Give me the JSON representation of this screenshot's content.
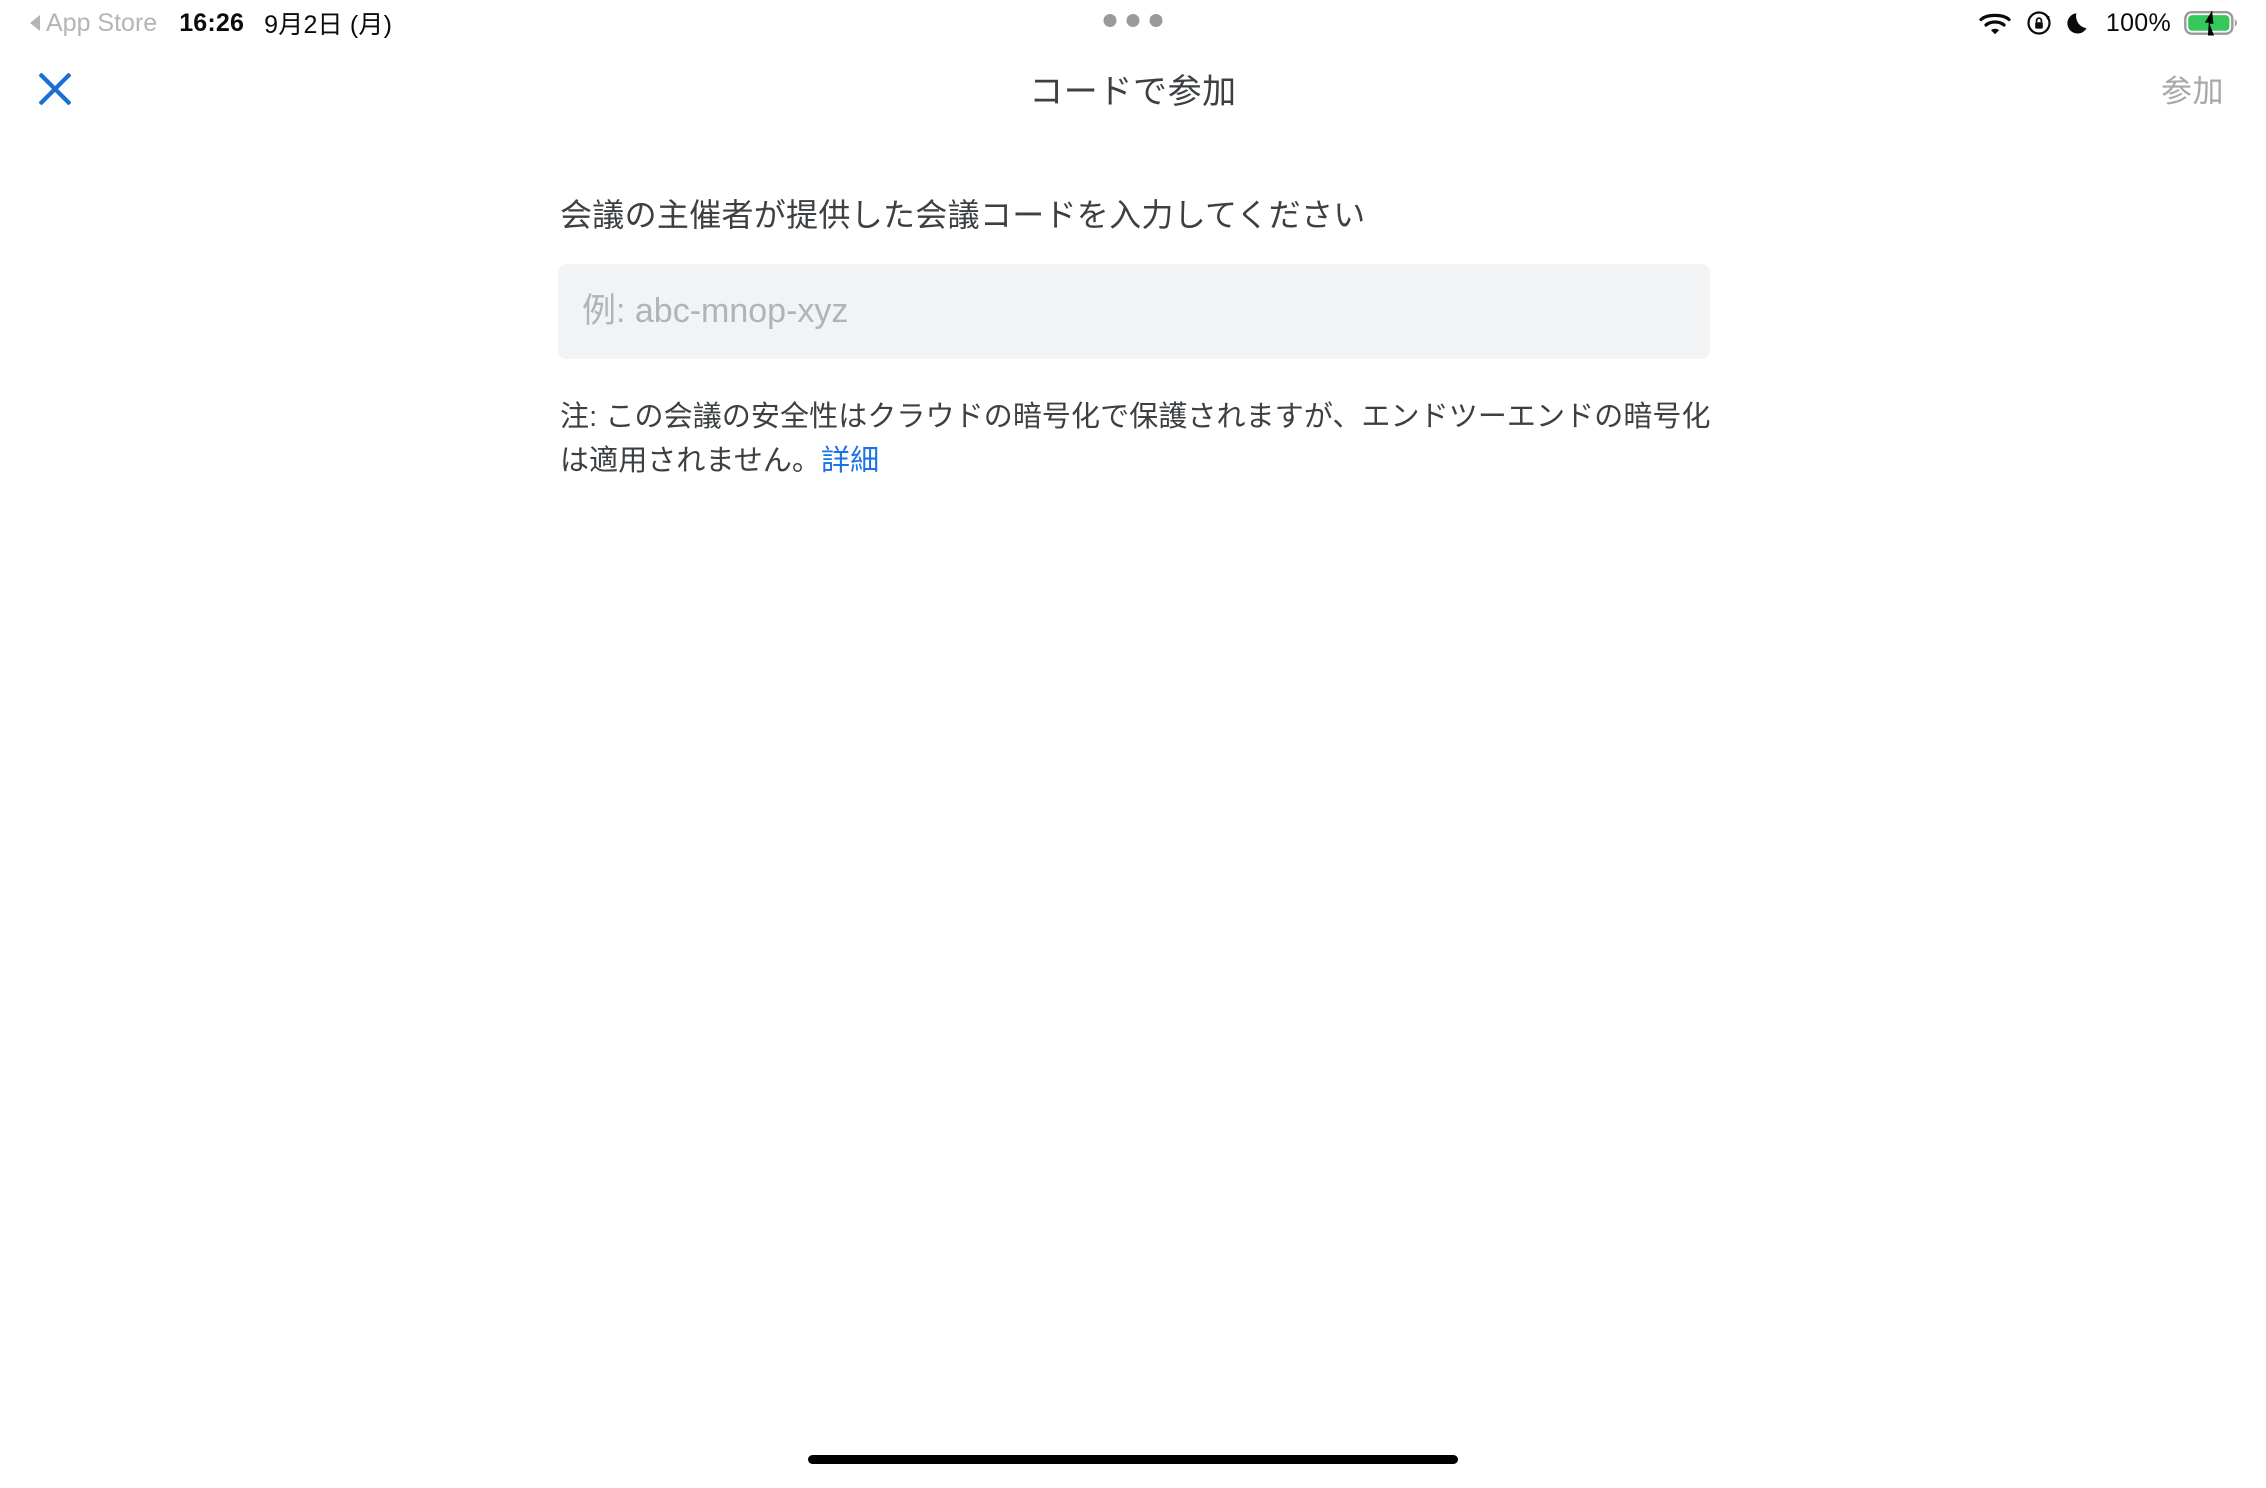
{
  "status_bar": {
    "back_app_label": "App Store",
    "back_icon": "back-triangle-icon",
    "time": "16:26",
    "date": "9月2日 (月)",
    "multitask_handle": "multitask-dots-icon",
    "wifi_icon": "wifi-icon",
    "rotation_lock_icon": "rotation-lock-icon",
    "do_not_disturb_icon": "crescent-moon-icon",
    "battery_percent": "100%",
    "battery_icon": "battery-charging-icon",
    "battery_color": "#34c759"
  },
  "header": {
    "close_icon": "close-x-icon",
    "close_color": "#1a6fd4",
    "title": "コードで参加",
    "join_label": "参加",
    "join_disabled_color": "#a8a8a8"
  },
  "main": {
    "prompt": "会議の主催者が提供した会議コードを入力してください",
    "code_input": {
      "value": "",
      "placeholder": "例: abc-mnop-xyz",
      "background": "#f1f3f4"
    },
    "note": {
      "text": "注: この会議の安全性はクラウドの暗号化で保護されますが、エンドツーエンドの暗号化は適用されません。",
      "link_label": "詳細",
      "link_color": "#1a73e8"
    }
  },
  "system": {
    "home_indicator": "home-indicator-bar"
  }
}
